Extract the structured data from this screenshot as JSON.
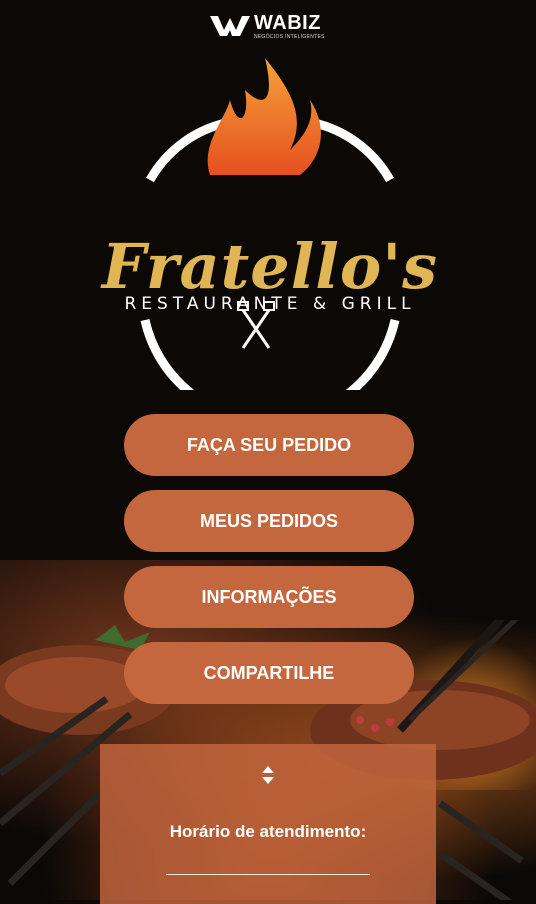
{
  "brand": {
    "name": "WABIZ",
    "tagline": "NEGÓCIOS INTELIGENTES"
  },
  "logo": {
    "title": "Fratello's",
    "subtitle": "RESTAURANTE & GRILL"
  },
  "menu": {
    "order_label": "FAÇA SEU PEDIDO",
    "my_orders_label": "MEUS PEDIDOS",
    "info_label": "INFORMAÇÕES",
    "share_label": "COMPARTILHE"
  },
  "hours": {
    "title": "Horário de atendimento:"
  },
  "colors": {
    "button": "#c4663e",
    "logo_gold": "#e0b654",
    "flame": "#f07a2e"
  }
}
